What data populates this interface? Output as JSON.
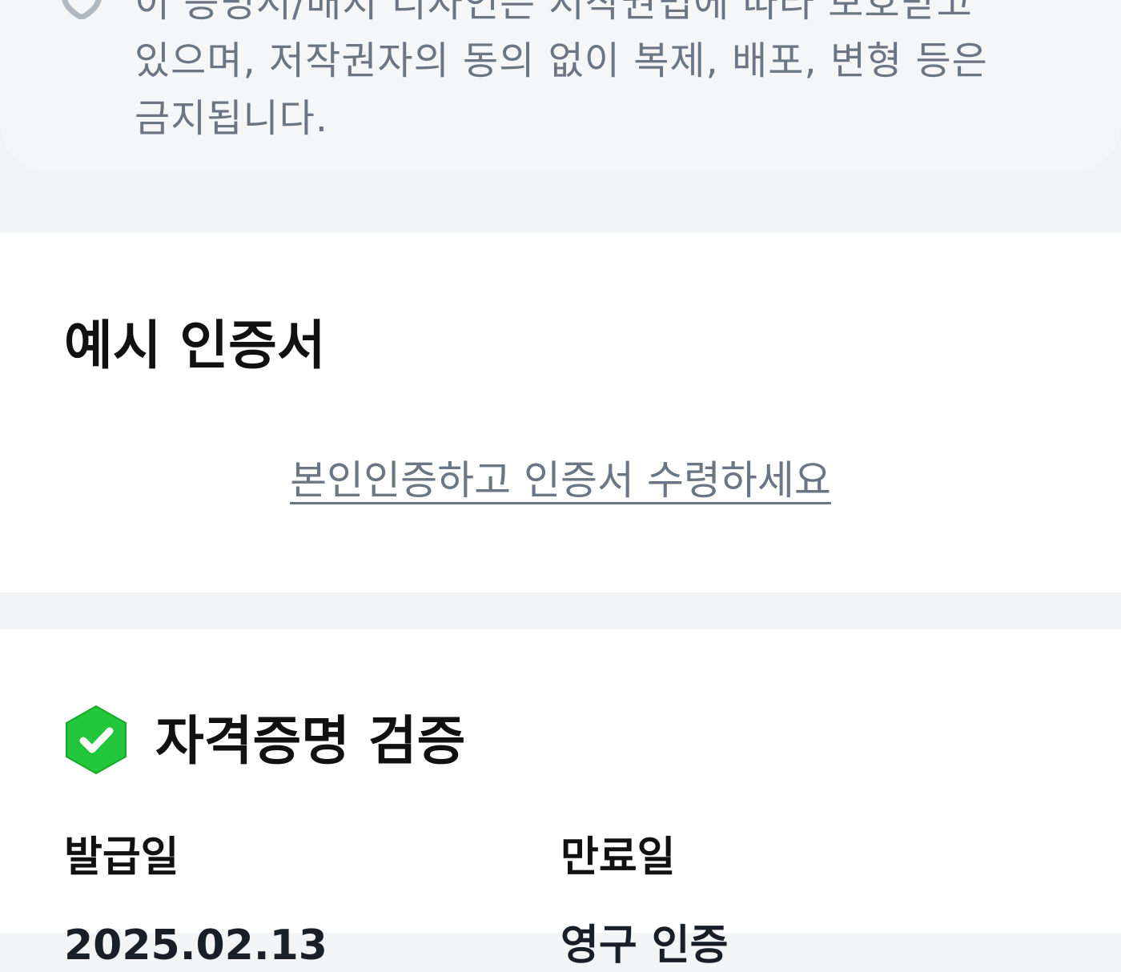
{
  "notice": {
    "icon": "shield-icon",
    "text": "이 증명서/배지 디자인은 저작권법에 따라 보호받고\n있으며, 저작권자의 동의 없이 복제, 배포, 변형 등은\n금지됩니다."
  },
  "example_section": {
    "title": "예시 인증서",
    "link_label": "본인인증하고 인증서 수령하세요"
  },
  "verification": {
    "badge_icon": "verified-check-icon",
    "title": "자격증명 검증",
    "issue_date_label": "발급일",
    "issue_date_value": "2025.02.13",
    "expiry_label": "만료일",
    "expiry_value": "영구 인증"
  },
  "colors": {
    "background": "#f2f4f6",
    "card": "#ffffff",
    "muted_text": "#6b7684",
    "badge_green": "#22c63b"
  }
}
